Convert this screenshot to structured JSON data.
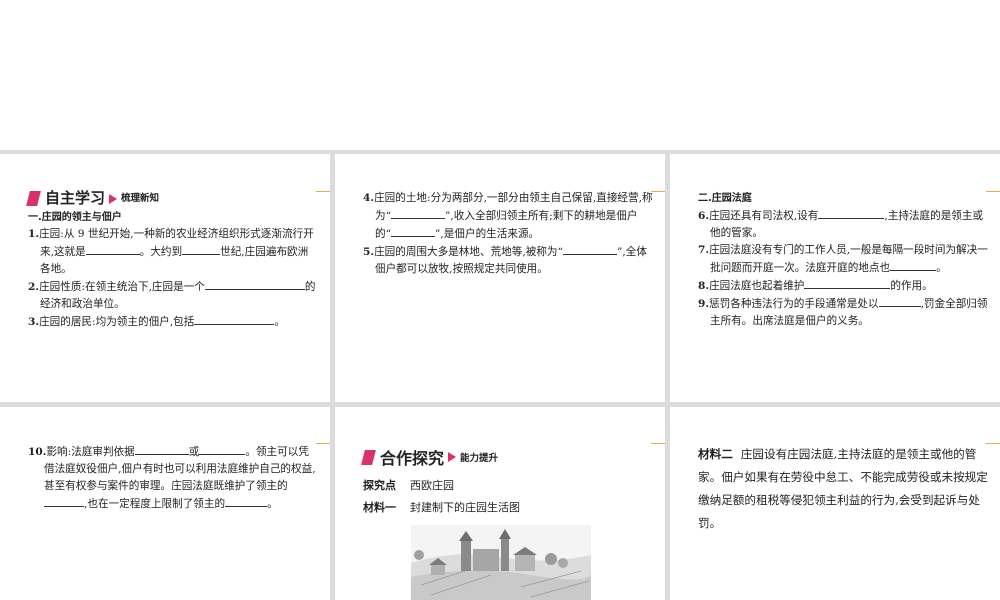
{
  "s1": {
    "heading": "自主学习",
    "heading_sub": "梳理新知",
    "section": "一.庄园的领主与佃户",
    "items": [
      {
        "num": "1.",
        "a": "庄园:从 9 世纪开始,一种新的农业经济组织形式逐渐流行开来,这就是",
        "b": "。大约到",
        "c": "世纪,庄园遍布欧洲各地。"
      },
      {
        "num": "2.",
        "a": "庄园性质:在领主统治下,庄园是一个",
        "b": "的经济和政治单位。"
      },
      {
        "num": "3.",
        "a": "庄园的居民:均为领主的佃户,包括",
        "b": "。"
      }
    ]
  },
  "s2": {
    "items": [
      {
        "num": "4.",
        "a": "庄园的土地:分为两部分,一部分由领主自己保留,直接经营,称为“",
        "b": "”,收入全部归领主所有;剩下的耕地是佃户的“",
        "c": "”,是佃户的生活来源。"
      },
      {
        "num": "5.",
        "a": "庄园的周围大多是林地、荒地等,被称为“",
        "b": "”,全体佃户都可以放牧,按照规定共同使用。"
      }
    ]
  },
  "s3": {
    "section": "二.庄园法庭",
    "items": [
      {
        "num": "6.",
        "a": "庄园还具有司法权,设有",
        "b": ",主持法庭的是领主或他的管家。"
      },
      {
        "num": "7.",
        "a": "庄园法庭没有专门的工作人员,一般是每隔一段时间为解决一批问题而开庭一次。法庭开庭的地点也",
        "b": "。"
      },
      {
        "num": "8.",
        "a": "庄园法庭也起着维护",
        "b": "的作用。"
      },
      {
        "num": "9.",
        "a": "惩罚各种违法行为的手段通常是处以",
        "b": ",罚金全部归领主所有。出席法庭是佃户的义务。"
      }
    ]
  },
  "s4": {
    "num": "10.",
    "a": "影响:法庭审判依据",
    "b": "或",
    "c": "。领主可以凭借法庭奴役佃户,佃户有时也可以利用法庭维护自己的权益,甚至有权参与案件的审理。庄园法庭既维护了领主的",
    "d": ",也在一定程度上限制了领主的",
    "e": "。"
  },
  "s5": {
    "heading": "合作探究",
    "heading_sub": "能力提升",
    "explore_label": "探究点",
    "explore_text": "西欧庄园",
    "material_label": "材料一",
    "material_text": "封建制下的庄园生活图"
  },
  "s6": {
    "material_label": "材料二",
    "material_text": "庄园设有庄园法庭,主持法庭的是领主或他的管家。佃户如果有在劳役中怠工、不能完成劳役或未按规定缴纳足额的租税等侵犯领主利益的行为,会受到起诉与处罚。"
  }
}
